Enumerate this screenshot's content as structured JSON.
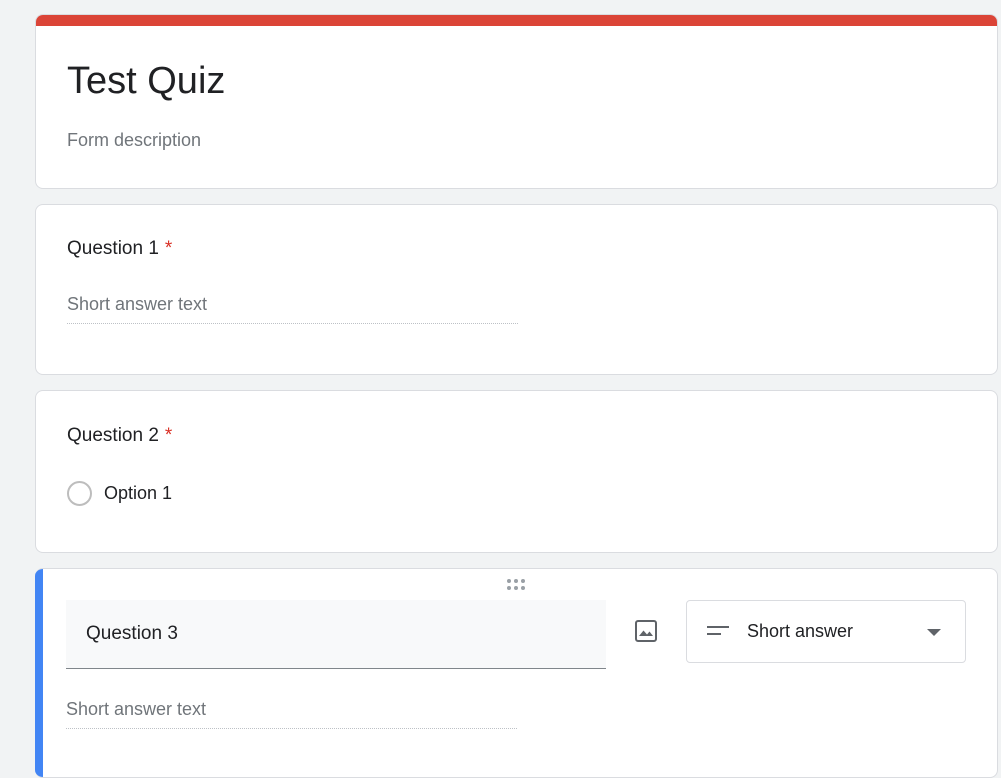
{
  "form": {
    "title": "Test Quiz",
    "description_placeholder": "Form description"
  },
  "questions": [
    {
      "title": "Question 1",
      "required_mark": "*",
      "answer_placeholder": "Short answer text"
    },
    {
      "title": "Question 2",
      "required_mark": "*",
      "options": [
        "Option 1"
      ]
    },
    {
      "title": "Question 3",
      "type_label": "Short answer",
      "answer_placeholder": "Short answer text"
    }
  ],
  "icons": {
    "image": "image-icon",
    "type": "short-answer-lines-icon",
    "dropdown": "chevron-down-icon",
    "drag": "drag-handle-icon"
  },
  "colors": {
    "header_accent": "#db4437",
    "active_accent": "#4285f4",
    "required": "#d93025"
  }
}
